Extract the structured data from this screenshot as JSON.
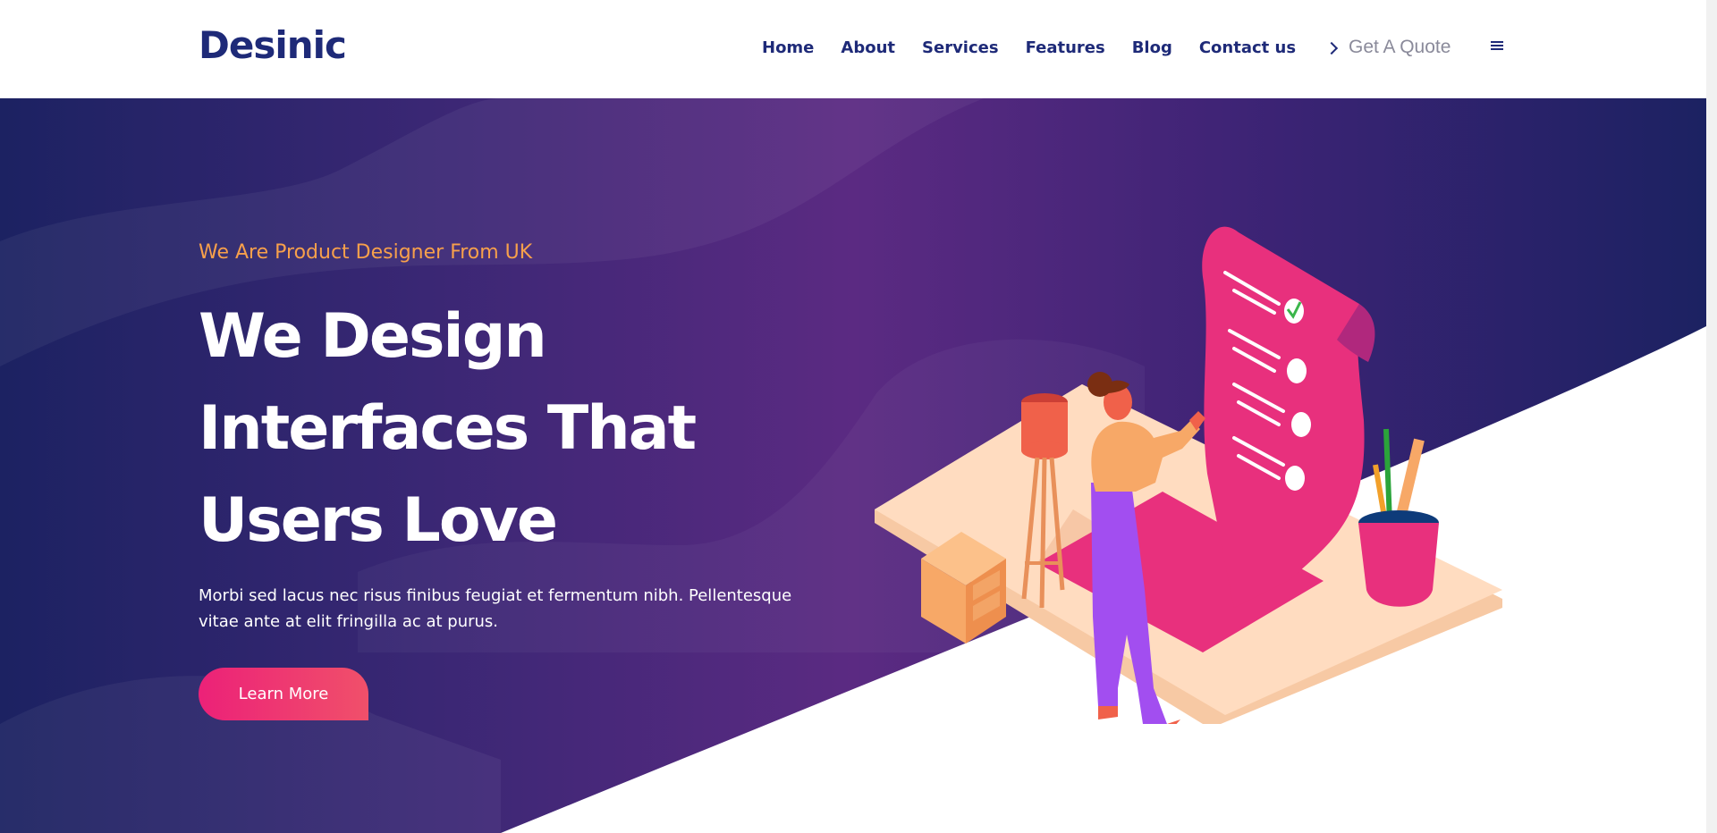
{
  "brand": {
    "logo": "Desinic",
    "primary_color": "#1e2a78",
    "accent_color": "#ec2178",
    "highlight_color": "#f7a04b"
  },
  "nav": {
    "items": [
      {
        "label": "Home"
      },
      {
        "label": "About"
      },
      {
        "label": "Services"
      },
      {
        "label": "Features"
      },
      {
        "label": "Blog"
      },
      {
        "label": "Contact us"
      }
    ],
    "quote_label": "Get A Quote",
    "quote_icon": "chevron-right-icon",
    "menu_icon": "hamburger-menu-icon"
  },
  "hero": {
    "subtitle": "We Are Product Designer From UK",
    "headline": [
      "We Design",
      "Interfaces That",
      "Users Love"
    ],
    "description": [
      "Morbi sed lacus nec risus finibus feugiat et fermentum nibh. Pellentesque",
      "vitae ante at elit fringilla ac at purus."
    ],
    "cta_label": "Learn More",
    "illustration": "woman-checklist-isometric-illustration"
  }
}
